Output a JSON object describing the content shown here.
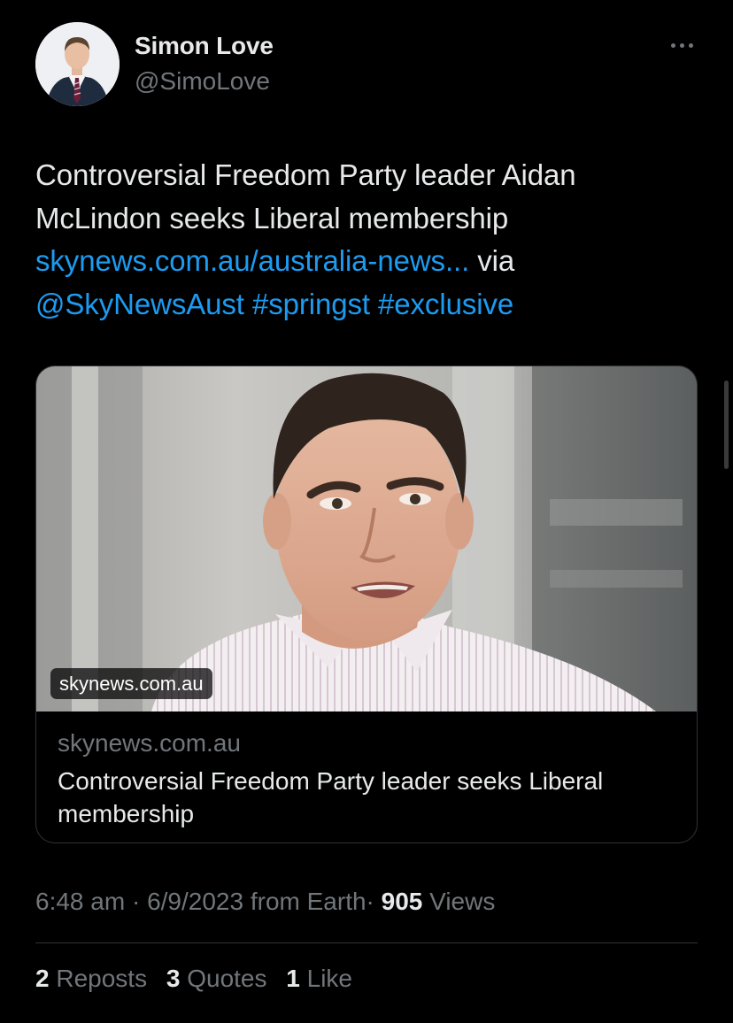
{
  "author": {
    "name": "Simon Love",
    "handle": "@SimoLove"
  },
  "tweet": {
    "text_line1": "Controversial Freedom Party leader Aidan",
    "text_line2": "McLindon seeks Liberal membership",
    "link": "skynews.com.au/australia-news...",
    "via": "via",
    "mention": "@SkyNewsAust",
    "hashtag1": "#springst",
    "hashtag2": "#exclusive"
  },
  "card": {
    "badge": "skynews.com.au",
    "domain": "skynews.com.au",
    "title": "Controversial Freedom Party leader seeks Liberal membership"
  },
  "meta": {
    "time": "6:48 am",
    "separator": "·",
    "date": "6/9/2023",
    "source": "from Earth",
    "views_count": "905",
    "views_label": "Views"
  },
  "stats": {
    "reposts_count": "2",
    "reposts_label": "Reposts",
    "quotes_count": "3",
    "quotes_label": "Quotes",
    "likes_count": "1",
    "likes_label": "Like"
  },
  "colors": {
    "background": "#000000",
    "text": "#e7e9ea",
    "secondary": "#71767b",
    "link": "#1d9bf0",
    "border": "#2f3336"
  },
  "icons": [
    "more-options-icon"
  ]
}
